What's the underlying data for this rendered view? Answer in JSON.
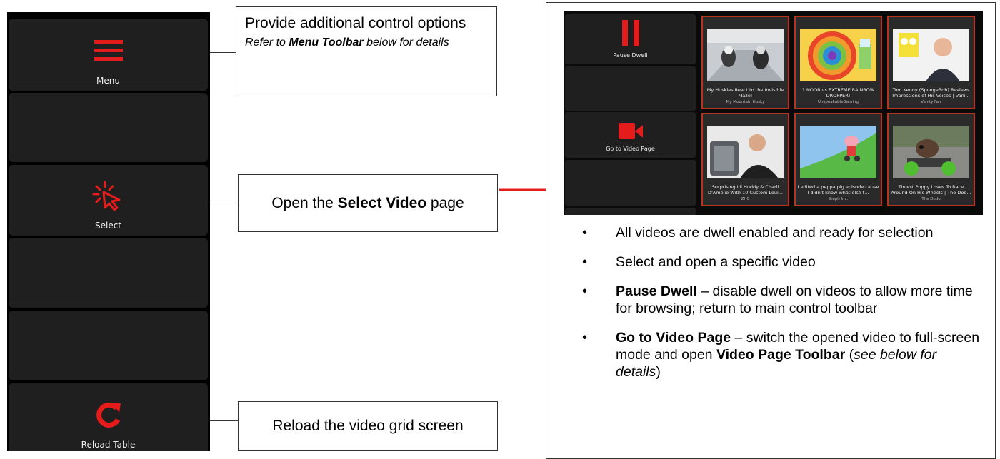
{
  "toolbar": {
    "menu_label": "Menu",
    "select_label": "Select",
    "reload_label": "Reload Table"
  },
  "callouts": {
    "menu_main": "Provide additional control options",
    "menu_sub_prefix": "Refer to ",
    "menu_sub_bold": "Menu Toolbar",
    "menu_sub_suffix": " below for details",
    "select_prefix": "Open the ",
    "select_bold": "Select Video",
    "select_suffix": " page",
    "reload": "Reload the video grid screen"
  },
  "screenshot": {
    "pause_label": "Pause Dwell",
    "goto_label": "Go to Video Page",
    "videos": [
      {
        "title": "My Huskies React to the Invisible Maze!",
        "channel": "My Mountain Husky"
      },
      {
        "title": "1 NOOB vs EXTREME RAINBOW DROPPER!",
        "channel": "UnspeakableGaming"
      },
      {
        "title": "Tom Kenny (SpongeBob) Reviews Impressions of His Voices | Vani...",
        "channel": "Vanity Fair"
      },
      {
        "title": "Surprising Lil Huddy & Charli D'Amelio With 10 Custom Loui...",
        "channel": "ZHC"
      },
      {
        "title": "I edited a peppa pig episode cause I didn't know what else t...",
        "channel": "Steph Inc."
      },
      {
        "title": "Tiniest Puppy Loves To Race Around On His Wheels | The Dod...",
        "channel": "The Dodo"
      }
    ]
  },
  "bullets": [
    {
      "text": "All videos are dwell enabled and ready for selection"
    },
    {
      "text": "Select and open a specific video"
    },
    {
      "bold": "Pause Dwell",
      "rest": " – disable dwell on videos to allow more time for browsing; return to main control toolbar"
    },
    {
      "bold": "Go to Video Page",
      "rest": " – switch the opened video to full-screen mode and open ",
      "bold2": "Video Page Toolbar",
      "rest2": " (",
      "italic": "see below for details",
      "rest3": ")"
    }
  ],
  "colors": {
    "accent_red": "#e51c1c",
    "tile_border": "#b83220"
  }
}
